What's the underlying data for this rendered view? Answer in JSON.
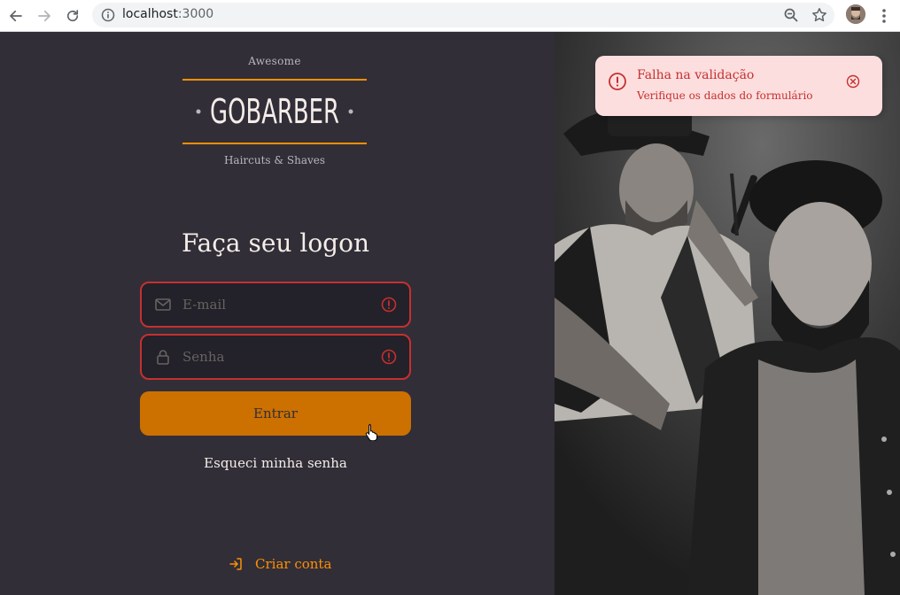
{
  "browser": {
    "url_host": "localhost",
    "url_port": ":3000"
  },
  "logo": {
    "top": "Awesome",
    "brand": "GOBARBER",
    "bottom": "Haircuts & Shaves"
  },
  "form": {
    "title": "Faça seu logon",
    "email_placeholder": "E-mail",
    "password_placeholder": "Senha",
    "submit_label": "Entrar",
    "forgot_label": "Esqueci minha senha"
  },
  "signup": {
    "label": "Criar conta"
  },
  "toast": {
    "title": "Falha na validação",
    "description": "Verifique os dados do formulário"
  },
  "colors": {
    "background": "#312e38",
    "accent": "#ff9000",
    "button": "#cc7000",
    "error": "#c53030",
    "toast_bg": "#fddede"
  },
  "icons": {
    "email": "mail-icon",
    "password": "lock-icon",
    "error": "alert-circle-icon",
    "signup": "log-in-icon",
    "close": "x-circle-icon"
  }
}
